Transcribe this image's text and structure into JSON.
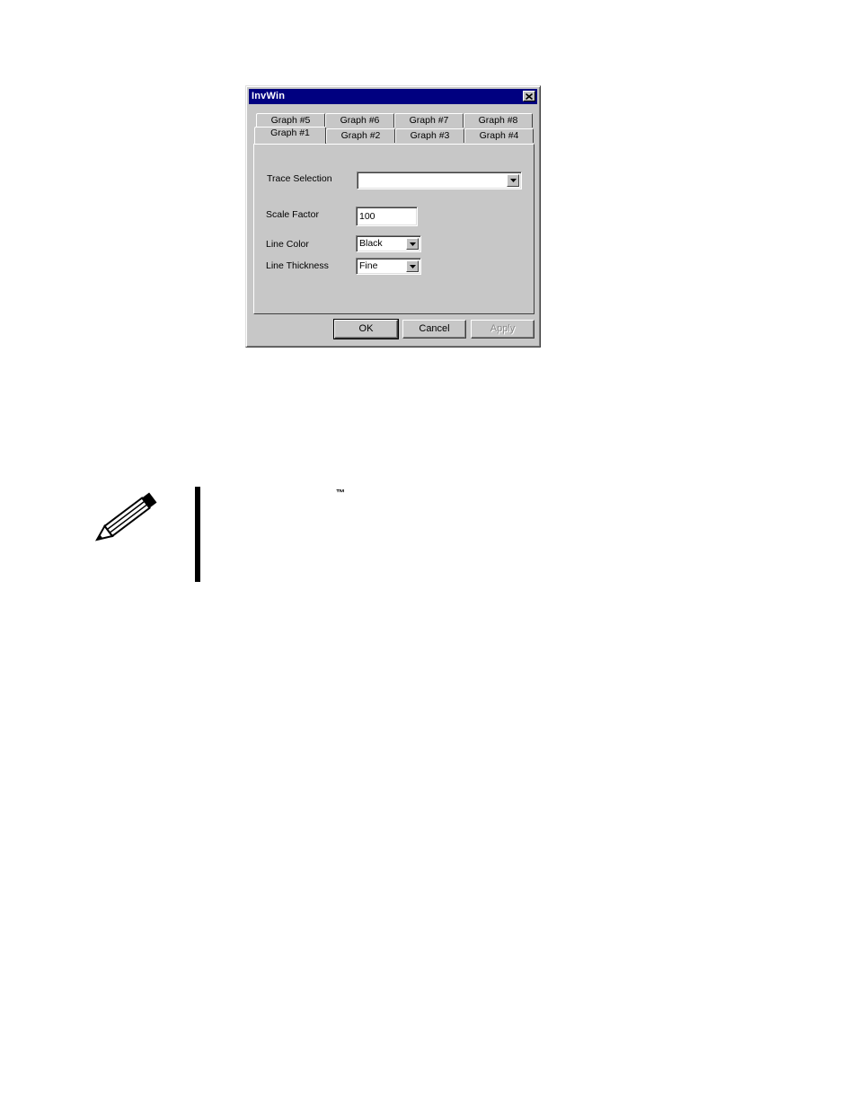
{
  "dialog": {
    "title": "InvWin",
    "tabs_row_back": [
      "Graph #5",
      "Graph #6",
      "Graph #7",
      "Graph #8"
    ],
    "tabs_row_front": [
      "Graph #1",
      "Graph #2",
      "Graph #3",
      "Graph #4"
    ],
    "active_tab": "Graph #1",
    "fields": {
      "trace_selection": {
        "label": "Trace Selection",
        "value": ""
      },
      "scale_factor": {
        "label": "Scale Factor",
        "value": "100"
      },
      "line_color": {
        "label": "Line Color",
        "value": "Black"
      },
      "line_thickness": {
        "label": "Line Thickness",
        "value": "Fine"
      }
    },
    "buttons": {
      "ok": "OK",
      "cancel": "Cancel",
      "apply": "Apply"
    }
  },
  "note": {
    "trademark": "™",
    "icon": "pencil-icon"
  }
}
